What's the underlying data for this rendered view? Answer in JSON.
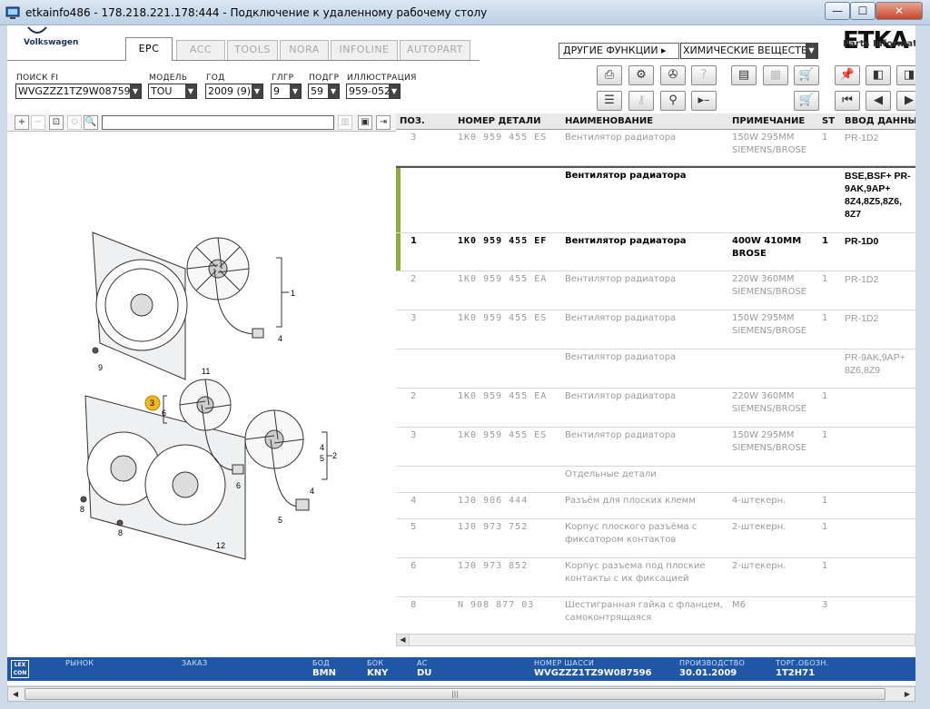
{
  "window": {
    "title": "etkainfo486 - 178.218.221.178:444 - Подключение к удаленному рабочему столу",
    "min_glyph": "—",
    "max_glyph": "☐",
    "close_glyph": "✕"
  },
  "brand": {
    "vw_label": "Volkswagen",
    "etka_logo": "ETKA",
    "etka_sub": "Parts Information"
  },
  "tabs": [
    {
      "label": "EPC",
      "active": true
    },
    {
      "label": "ACC",
      "active": false
    },
    {
      "label": "TOOLS",
      "active": false
    },
    {
      "label": "NORA",
      "active": false
    },
    {
      "label": "INFOLINE",
      "active": false
    },
    {
      "label": "AUTOPART",
      "active": false
    }
  ],
  "functions": {
    "other_label": "ДРУГИЕ ФУНКЦИИ ▸",
    "chem_value": "ХИМИЧЕСКИЕ ВЕЩЕСТВА"
  },
  "filters": {
    "fi": {
      "label": "ПОИСК FI",
      "value": "WVGZZZ1TZ9W087596"
    },
    "model": {
      "label": "МОДЕЛЬ",
      "value": "TOU"
    },
    "year": {
      "label": "ГОД",
      "value": "2009 (9)"
    },
    "group": {
      "label": "ГЛГР",
      "value": "9"
    },
    "subgroup": {
      "label": "ПОДГР",
      "value": "59"
    },
    "illustration": {
      "label": "ИЛЛЮСТРАЦИЯ",
      "value": "959-052"
    }
  },
  "table": {
    "headers": {
      "pos": "ПОЗ.",
      "pn": "НОМЕР ДЕТАЛИ",
      "name": "НАИМЕНОВАНИЕ",
      "note": "ПРИМЕЧАНИЕ",
      "st": "ST",
      "inp": "ВВОД ДАННЫХ"
    },
    "rows": [
      {
        "pos": "3",
        "pn": "1K0 959 455 ES",
        "name": "Вентилятор радиатора",
        "note": "150W    295MM SIEMENS/BROSE",
        "st": "1",
        "inp": "PR-1D2",
        "bold": false
      },
      {
        "pos": "",
        "pn": "",
        "name": "Вентилятор радиатора",
        "note": "",
        "st": "",
        "inp": "BSE,BSF+ PR-9AK,9AP+ 8Z4,8Z5,8Z6, 8Z7",
        "bold": true
      },
      {
        "pos": "1",
        "pn": "1K0 959 455 EF",
        "name": "Вентилятор радиатора",
        "note": "400W    410MM BROSE",
        "st": "1",
        "inp": "PR-1D0",
        "bold": true
      },
      {
        "pos": "2",
        "pn": "1K0 959 455 EA",
        "name": "Вентилятор радиатора",
        "note": "220W    360MM SIEMENS/BROSE",
        "st": "1",
        "inp": "PR-1D2",
        "bold": false
      },
      {
        "pos": "3",
        "pn": "1K0 959 455 ES",
        "name": "Вентилятор радиатора",
        "note": "150W    295MM SIEMENS/BROSE",
        "st": "1",
        "inp": "PR-1D2",
        "bold": false
      },
      {
        "pos": "",
        "pn": "",
        "name": "Вентилятор радиатора",
        "note": "",
        "st": "",
        "inp": "PR-9AK,9AP+ 8Z6,8Z9",
        "bold": false
      },
      {
        "pos": "2",
        "pn": "1K0 959 455 EA",
        "name": "Вентилятор радиатора",
        "note": "220W    360MM SIEMENS/BROSE",
        "st": "1",
        "inp": "",
        "bold": false
      },
      {
        "pos": "3",
        "pn": "1K0 959 455 ES",
        "name": "Вентилятор радиатора",
        "note": "150W    295MM SIEMENS/BROSE",
        "st": "1",
        "inp": "",
        "bold": false
      },
      {
        "pos": "",
        "pn": "",
        "name": "Отдельные детали",
        "note": "",
        "st": "",
        "inp": "",
        "bold": false
      },
      {
        "pos": "4",
        "pn": "1J0 906 444",
        "name": "Разъём для плоских клемм",
        "note": "4-штекерн.",
        "st": "1",
        "inp": "",
        "bold": false
      },
      {
        "pos": "5",
        "pn": "1J0 973 752",
        "name": "Корпус плоского разъёма с фиксатором контактов",
        "note": "2-штекерн.",
        "st": "1",
        "inp": "",
        "bold": false
      },
      {
        "pos": "6",
        "pn": "1J0 973 852",
        "name": "Корпус разъема под плоские контакты с их фиксацией",
        "note": "2-штекерн.",
        "st": "1",
        "inp": "",
        "bold": false
      },
      {
        "pos": "8",
        "pn": "N    908 877 03",
        "name": "Шестигранная гайка с фланцем, самоконтрящаяся",
        "note": "M6",
        "st": "3",
        "inp": "",
        "bold": false
      }
    ]
  },
  "illustration": {
    "callouts": [
      "1",
      "4",
      "9",
      "11",
      "3",
      "6",
      "4",
      "2",
      "5",
      "6",
      "4",
      "8",
      "5",
      "8",
      "12"
    ]
  },
  "status": {
    "lexcon": "LEX CON",
    "market_label": "РЫНОК",
    "order_label": "ЗАКАЗ",
    "bod_label": "БОД",
    "bod_value": "BMN",
    "bok_label": "БОК",
    "bok_value": "KNY",
    "ac_label": "АС",
    "ac_value": "DU",
    "chassis_label": "НОМЕР ШАССИ",
    "chassis_value": "WVGZZZ1TZ9W087596",
    "prod_label": "ПРОИЗВОДСТВО",
    "prod_value": "30.01.2009",
    "trade_label": "ТОРГ.ОБОЗН.",
    "trade_value": "1T2H71"
  },
  "scroll": {
    "grip": "|||"
  }
}
